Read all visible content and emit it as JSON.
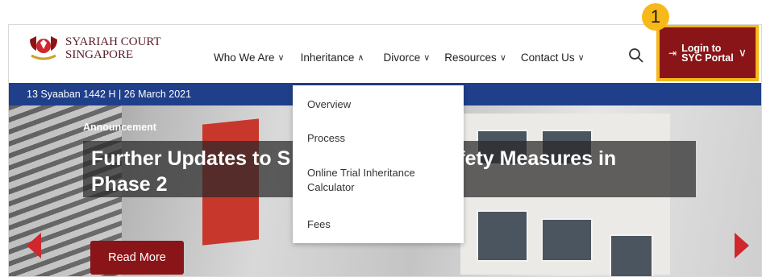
{
  "brand": {
    "line1": "SYARIAH COURT",
    "line2": "SINGAPORE"
  },
  "nav": [
    {
      "label": "Who We Are",
      "chevron": "∨"
    },
    {
      "label": "Inheritance",
      "chevron": "∧"
    },
    {
      "label": "Divorce",
      "chevron": "∨"
    },
    {
      "label": "Resources",
      "chevron": "∨"
    },
    {
      "label": "Contact Us",
      "chevron": "∨"
    }
  ],
  "login": {
    "line1": "Login to",
    "line2": "SYC Portal",
    "icon": "login-arrow-icon"
  },
  "callout_number": "1",
  "date_text": "13 Syaaban 1442 H | 26 March 2021",
  "hero": {
    "tag": "Announcement",
    "headline_left": "Further Updates to S",
    "headline_right": "fety Measures in",
    "headline_line2": "Phase 2",
    "read_more": "Read More"
  },
  "dropdown": {
    "items": [
      "Overview",
      "Process",
      "Online Trial Inheritance Calculator",
      "Fees"
    ]
  },
  "colors": {
    "brand_red": "#8a1518",
    "nav_blue": "#1f3f8a",
    "highlight": "#f6b919",
    "arrow_red": "#d0262d"
  }
}
